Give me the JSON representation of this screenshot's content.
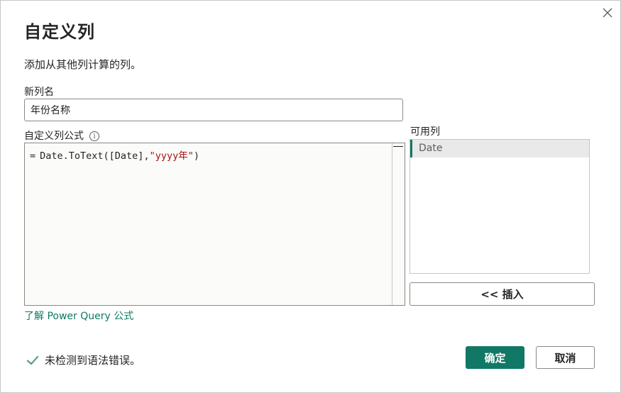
{
  "dialog": {
    "title": "自定义列",
    "subtitle": "添加从其他列计算的列。"
  },
  "new_column": {
    "label": "新列名",
    "value": "年份名称"
  },
  "formula": {
    "label": "自定义列公式",
    "info_icon": "i",
    "prefix": "=",
    "code": "Date.ToText([Date],",
    "string_literal": "\"yyyy年\"",
    "suffix": ")"
  },
  "available_columns": {
    "label": "可用列",
    "items": [
      "Date"
    ]
  },
  "buttons": {
    "insert": "<< 插入",
    "ok": "确定",
    "cancel": "取消"
  },
  "learn_link": "了解 Power Query 公式",
  "status": {
    "text": "未检测到语法错误。",
    "icon": "check-icon"
  },
  "colors": {
    "accent": "#117865",
    "string": "#a31515"
  }
}
